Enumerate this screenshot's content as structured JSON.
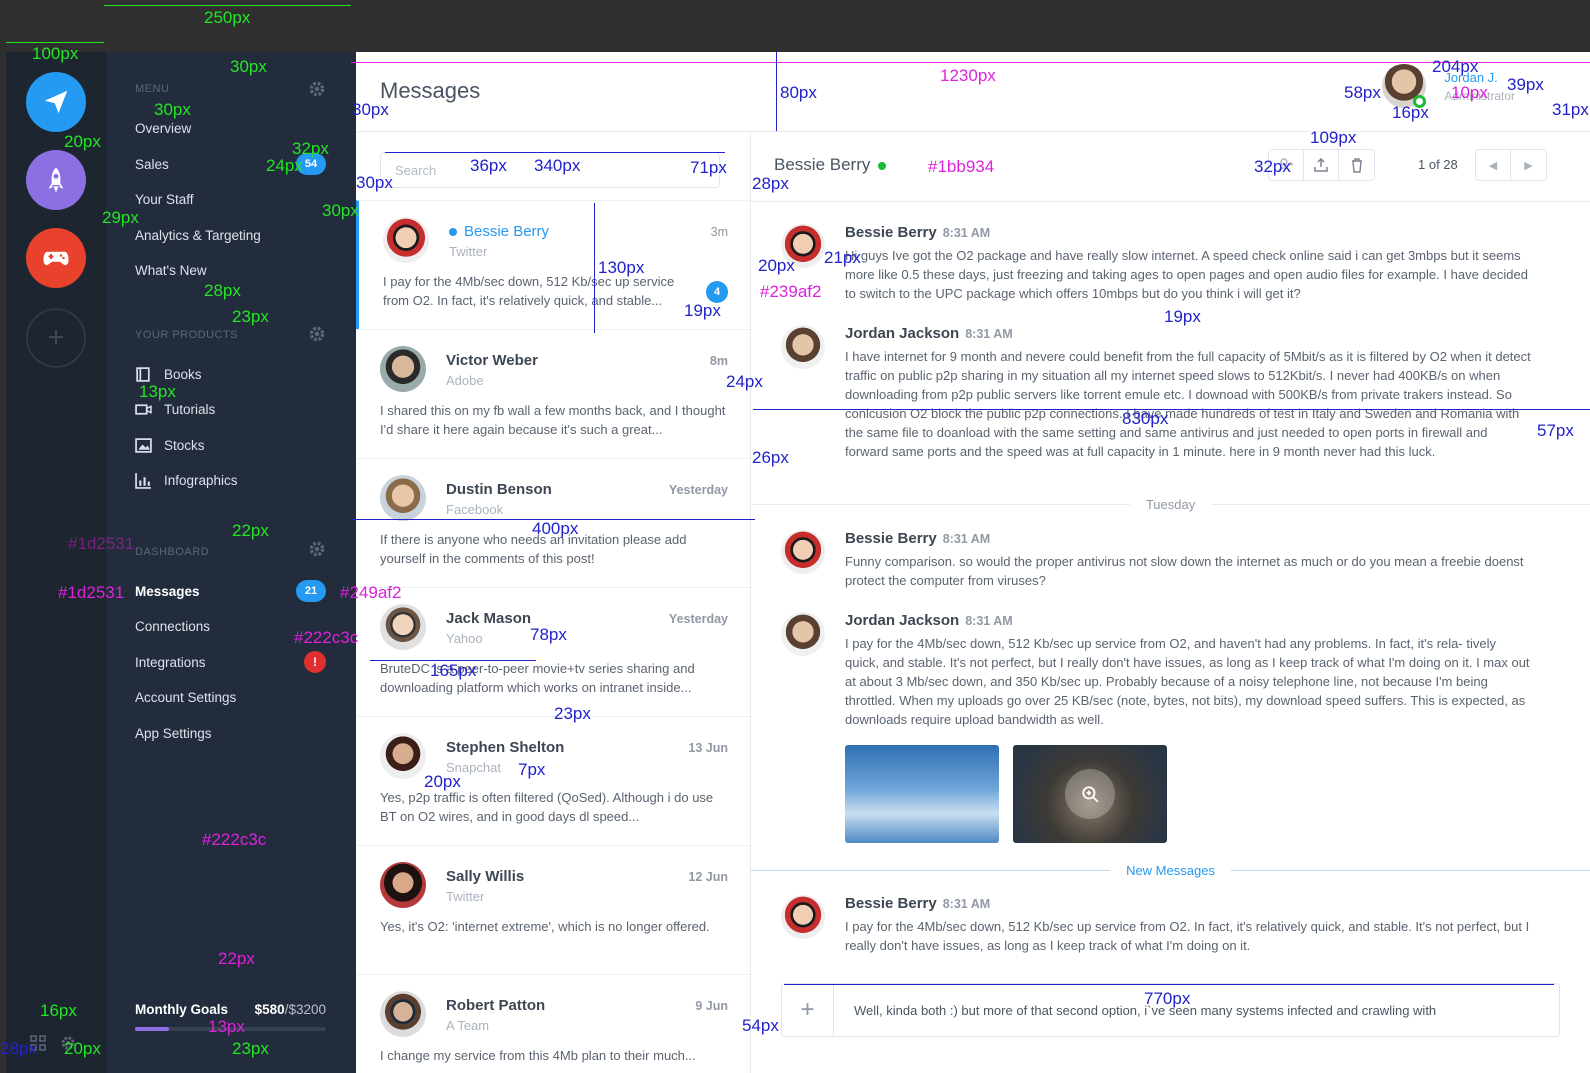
{
  "nav": {
    "menu_label": "MENU",
    "menu_items": [
      {
        "label": "Overview"
      },
      {
        "label": "Sales",
        "badge": "54"
      },
      {
        "label": "Your Staff"
      },
      {
        "label": "Analytics & Targeting"
      },
      {
        "label": "What's New"
      }
    ],
    "products_label": "YOUR PRODUCTS",
    "product_items": [
      {
        "label": "Books",
        "icon": "book-icon"
      },
      {
        "label": "Tutorials",
        "icon": "video-icon"
      },
      {
        "label": "Stocks",
        "icon": "image-icon"
      },
      {
        "label": "Infographics",
        "icon": "bar-chart-icon"
      }
    ],
    "dashboard_label": "DASHBOARD",
    "dashboard_items": [
      {
        "label": "Messages",
        "badge": "21"
      },
      {
        "label": "Connections"
      },
      {
        "label": "Integrations",
        "badge": "!"
      },
      {
        "label": "Account Settings"
      },
      {
        "label": "App Settings"
      }
    ],
    "goal": {
      "label": "Monthly Goals",
      "current": "$580",
      "target": "/$3200",
      "progress": 0.18
    }
  },
  "rail": {
    "apps": [
      {
        "icon": "paper-plane-icon",
        "color": "#249af2"
      },
      {
        "icon": "rocket-icon",
        "color": "#8b6fe3"
      },
      {
        "icon": "gamepad-icon",
        "color": "#e8412c"
      }
    ],
    "add_label": "+"
  },
  "header": {
    "title": "Messages",
    "user": {
      "name": "Jordan J.",
      "role": "Administrator",
      "status_color": "#1bb934"
    }
  },
  "list": {
    "search_placeholder": "Search",
    "conversations": [
      {
        "name": "Bessie Berry",
        "source": "Twitter",
        "time": "3m",
        "preview": "I pay for the 4Mb/sec down, 512 Kb/sec up service from O2. In fact, it's relatively quick, and stable...",
        "unread": "4",
        "active": true
      },
      {
        "name": "Victor Weber",
        "source": "Adobe",
        "time": "8m",
        "preview": "I shared this on my fb wall a few months back, and I thought I'd share it here again because it's such a great..."
      },
      {
        "name": "Dustin Benson",
        "source": "Facebook",
        "time": "Yesterday",
        "preview": "If there is anyone who needs an invitation please add yourself in the comments of this post!"
      },
      {
        "name": "Jack Mason",
        "source": "Yahoo",
        "time": "Yesterday",
        "preview": "BruteDC is a peer-to-peer movie+tv series sharing and downloading platform which works on intranet inside..."
      },
      {
        "name": "Stephen Shelton",
        "source": "Snapchat",
        "time": "13 Jun",
        "preview": "Yes, p2p traffic is often filtered (QoSed). Although i do use BT on O2 wires, and in good days dl speed..."
      },
      {
        "name": "Sally Willis",
        "source": "Twitter",
        "time": "12 Jun",
        "preview": "Yes, it's O2: 'internet extreme', which is no longer offered."
      },
      {
        "name": "Robert Patton",
        "source": "A Team",
        "time": "9 Jun",
        "preview": "I change my service from this 4Mb plan to their much..."
      }
    ]
  },
  "thread": {
    "contact": "Bessie Berry",
    "status_color": "#1bb934",
    "pager": "1 of 28",
    "messages": [
      {
        "author": "Bessie Berry",
        "time": "8:31 AM",
        "text": "Hi guys Ive got the O2 package and have really slow internet. A speed check online said i can get 3mbps but it seems more like 0.5 these days, just freezing and taking ages to open pages and open audio files for example. I have decided to switch to the UPC package which offers 10mbps but do you think i will get it?"
      },
      {
        "author": "Jordan Jackson",
        "time": "8:31 AM",
        "text": "I have internet for 9 month and nevere could benefit from the full capacity of 5Mbit/s as it is filtered by O2 when it detect traffic on public p2p sharing in my situation all my internet speed slows to 512Kbit/s. I never had 400KB/s on when downloading from p2p public servers like torrent emule etc. I downoad with 500KB/s from private trakers instead. So conlcusion O2 block the public p2p connections. I have made hundreds of test in Italy and Sweden and Romania with the same file to doanload with the same setting and same antivirus and just needed to open ports in firewall and forward same ports and the speed was at full capacity in 1 minute. here in 9 month never had this luck."
      },
      {
        "author": "Bessie Berry",
        "time": "8:31 AM",
        "text": "Funny comparison. so would the proper antivirus not slow down the internet as much or do you mean a freebie doenst protect the computer from viruses?"
      },
      {
        "author": "Jordan Jackson",
        "time": "8:31 AM",
        "text": "I pay for the 4Mb/sec down, 512 Kb/sec up service from O2, and haven't had any problems. In fact, it's rela- tively quick, and stable. It's not perfect, but I really don't have issues, as long as I keep track of what I'm doing on it. I max out at about 3 Mb/sec down, and 350 Kb/sec up. Probably because of a noisy telephone line, not because I'm being throttled. When my uploads go over 25 KB/sec (note, bytes, not bits), my download speed suffers. This is expected, as downloads require upload bandwidth as well."
      },
      {
        "author": "Bessie Berry",
        "time": "8:31 AM",
        "text": "I pay for the 4Mb/sec down, 512 Kb/sec up service from O2. In fact, it's relatively quick, and stable. It's not perfect, but I really don't have issues, as long as I keep track of what I'm doing on it."
      }
    ],
    "day_separator": "Tuesday",
    "new_separator": "New Messages",
    "composer_text": "Well, kinda both :) but more of that second option, i`ve seen many systems infected and crawling with"
  },
  "annotations": {
    "green": [
      "250px",
      "100px",
      "30px",
      "30px",
      "20px",
      "32px",
      "24px",
      "29px",
      "30px",
      "28px",
      "23px",
      "30px",
      "13px",
      "22px",
      "16px",
      "20px",
      "23px"
    ],
    "blue": [
      "80px",
      "36px",
      "340px",
      "71px",
      "30px",
      "130px",
      "19px",
      "28px",
      "20px",
      "21px",
      "19px",
      "24px",
      "26px",
      "830px",
      "57px",
      "400px",
      "78px",
      "165px",
      "23px",
      "20px",
      "7px",
      "54px",
      "770px",
      "58px",
      "16px",
      "109px",
      "32px",
      "204px",
      "39px",
      "31px",
      "28px",
      "30px"
    ],
    "magenta": [
      "1230px",
      "#1bb934",
      "#239af2",
      "#1d2531",
      "#1d2531",
      "#249af2",
      "#222c3c",
      "#222c3c",
      "22px",
      "13px",
      "10px"
    ]
  }
}
